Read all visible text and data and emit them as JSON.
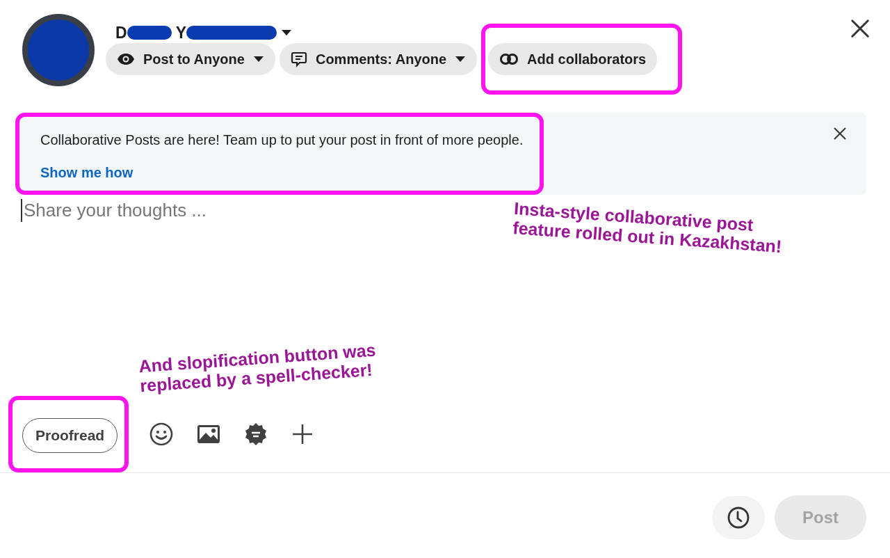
{
  "author": {
    "name_fragments": [
      "D",
      "Y"
    ],
    "has_menu": true
  },
  "chips": [
    {
      "kind": "visibility",
      "label": "Post to Anyone",
      "dropdown": true,
      "highlighted": false
    },
    {
      "kind": "comments",
      "label": "Comments: Anyone",
      "dropdown": true,
      "highlighted": false
    },
    {
      "kind": "collaborators",
      "label": "Add collaborators",
      "dropdown": false,
      "highlighted": true
    }
  ],
  "banner": {
    "text": "Collaborative Posts are here! Team up to put your post in front of more people.",
    "link": "Show me how",
    "highlighted": true
  },
  "editor": {
    "placeholder": "Share your thoughts ..."
  },
  "toolbar": {
    "proofread": {
      "label": "Proofread",
      "highlighted": true
    },
    "tools": [
      {
        "kind": "emoji"
      },
      {
        "kind": "image"
      },
      {
        "kind": "badge"
      },
      {
        "kind": "more"
      }
    ]
  },
  "footer": {
    "post": {
      "label": "Post",
      "disabled": true
    }
  },
  "annotations": [
    {
      "text": "Insta-style collaborative post feature rolled out in Kazakhstan!"
    },
    {
      "text": "And slopification button was replaced by a spell-checker!"
    }
  ]
}
